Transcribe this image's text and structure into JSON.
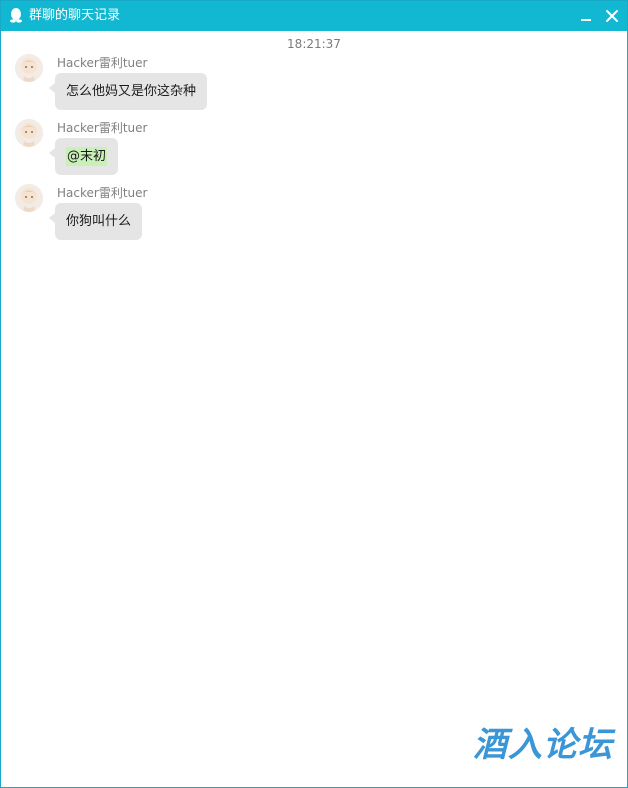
{
  "window": {
    "title": "群聊的聊天记录",
    "accent_color": "#12b7d1"
  },
  "titlebar": {
    "minimize_icon": "minimize-icon",
    "close_icon": "close-icon"
  },
  "chat": {
    "timestamp": "18:21:37",
    "messages": [
      {
        "sender": "Hacker雷利tuer",
        "text": "怎么他妈又是你这杂种",
        "mention": ""
      },
      {
        "sender": "Hacker雷利tuer",
        "text": "",
        "mention": "@末初"
      },
      {
        "sender": "Hacker雷利tuer",
        "text": "你狗叫什么",
        "mention": ""
      }
    ]
  },
  "watermark": {
    "text": "酒入论坛"
  }
}
